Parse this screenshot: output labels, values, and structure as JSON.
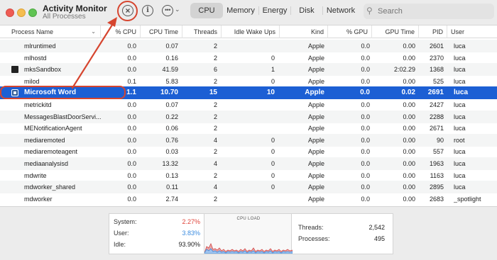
{
  "app": {
    "title": "Activity Monitor",
    "subtitle": "All Processes"
  },
  "toolbar": {
    "info_glyph": "i",
    "more_glyph": "•••",
    "tabs": [
      "CPU",
      "Memory",
      "Energy",
      "Disk",
      "Network"
    ],
    "active_tab": "CPU",
    "search_placeholder": "Search"
  },
  "table": {
    "columns": [
      "Process Name",
      "% CPU",
      "CPU Time",
      "Threads",
      "Idle Wake Ups",
      "Kind",
      "% GPU",
      "GPU Time",
      "PID",
      "User"
    ],
    "rows": [
      {
        "icon": "none",
        "name": "mlruntimed",
        "cpu": "0.0",
        "cpu_time": "0.07",
        "threads": "2",
        "idle": "",
        "kind": "Apple",
        "gpu": "0.0",
        "gpu_time": "0.00",
        "pid": "2601",
        "user": "luca"
      },
      {
        "icon": "none",
        "name": "mlhostd",
        "cpu": "0.0",
        "cpu_time": "0.16",
        "threads": "2",
        "idle": "0",
        "kind": "Apple",
        "gpu": "0.0",
        "gpu_time": "0.00",
        "pid": "2370",
        "user": "luca"
      },
      {
        "icon": "terminal-icon",
        "name": "mksSandbox",
        "cpu": "0.0",
        "cpu_time": "41.59",
        "threads": "6",
        "idle": "1",
        "kind": "Apple",
        "gpu": "0.0",
        "gpu_time": "2:02.29",
        "pid": "1368",
        "user": "luca"
      },
      {
        "icon": "none",
        "name": "milod",
        "cpu": "0.1",
        "cpu_time": "5.83",
        "threads": "2",
        "idle": "0",
        "kind": "Apple",
        "gpu": "0.0",
        "gpu_time": "0.00",
        "pid": "525",
        "user": "luca"
      },
      {
        "icon": "word-icon",
        "name": "Microsoft Word",
        "cpu": "1.1",
        "cpu_time": "10.70",
        "threads": "15",
        "idle": "10",
        "kind": "Apple",
        "gpu": "0.0",
        "gpu_time": "0.02",
        "pid": "2691",
        "user": "luca",
        "selected": true
      },
      {
        "icon": "none",
        "name": "metrickitd",
        "cpu": "0.0",
        "cpu_time": "0.07",
        "threads": "2",
        "idle": "",
        "kind": "Apple",
        "gpu": "0.0",
        "gpu_time": "0.00",
        "pid": "2427",
        "user": "luca"
      },
      {
        "icon": "none",
        "name": "MessagesBlastDoorServi...",
        "cpu": "0.0",
        "cpu_time": "0.22",
        "threads": "2",
        "idle": "",
        "kind": "Apple",
        "gpu": "0.0",
        "gpu_time": "0.00",
        "pid": "2288",
        "user": "luca"
      },
      {
        "icon": "none",
        "name": "MENotificationAgent",
        "cpu": "0.0",
        "cpu_time": "0.06",
        "threads": "2",
        "idle": "",
        "kind": "Apple",
        "gpu": "0.0",
        "gpu_time": "0.00",
        "pid": "2671",
        "user": "luca"
      },
      {
        "icon": "none",
        "name": "mediaremoted",
        "cpu": "0.0",
        "cpu_time": "0.76",
        "threads": "4",
        "idle": "0",
        "kind": "Apple",
        "gpu": "0.0",
        "gpu_time": "0.00",
        "pid": "90",
        "user": "root"
      },
      {
        "icon": "none",
        "name": "mediaremoteagent",
        "cpu": "0.0",
        "cpu_time": "0.03",
        "threads": "2",
        "idle": "0",
        "kind": "Apple",
        "gpu": "0.0",
        "gpu_time": "0.00",
        "pid": "557",
        "user": "luca"
      },
      {
        "icon": "none",
        "name": "mediaanalysisd",
        "cpu": "0.0",
        "cpu_time": "13.32",
        "threads": "4",
        "idle": "0",
        "kind": "Apple",
        "gpu": "0.0",
        "gpu_time": "0.00",
        "pid": "1963",
        "user": "luca"
      },
      {
        "icon": "none",
        "name": "mdwrite",
        "cpu": "0.0",
        "cpu_time": "0.13",
        "threads": "2",
        "idle": "0",
        "kind": "Apple",
        "gpu": "0.0",
        "gpu_time": "0.00",
        "pid": "1163",
        "user": "luca"
      },
      {
        "icon": "none",
        "name": "mdworker_shared",
        "cpu": "0.0",
        "cpu_time": "0.11",
        "threads": "4",
        "idle": "0",
        "kind": "Apple",
        "gpu": "0.0",
        "gpu_time": "0.00",
        "pid": "2895",
        "user": "luca"
      },
      {
        "icon": "none",
        "name": "mdworker",
        "cpu": "0.0",
        "cpu_time": "2.74",
        "threads": "2",
        "idle": "",
        "kind": "Apple",
        "gpu": "0.0",
        "gpu_time": "0.00",
        "pid": "2683",
        "user": "_spotlight"
      }
    ]
  },
  "summary": {
    "system_label": "System:",
    "system_value": "2.27%",
    "user_label": "User:",
    "user_value": "3.83%",
    "idle_label": "Idle:",
    "idle_value": "93.90%",
    "graph_title": "CPU LOAD",
    "threads_label": "Threads:",
    "threads_value": "2,542",
    "processes_label": "Processes:",
    "processes_value": "495"
  },
  "colors": {
    "selection": "#1c5fd4",
    "annotation": "#d6452f",
    "system": "#e0443a",
    "user": "#3a8be0"
  }
}
